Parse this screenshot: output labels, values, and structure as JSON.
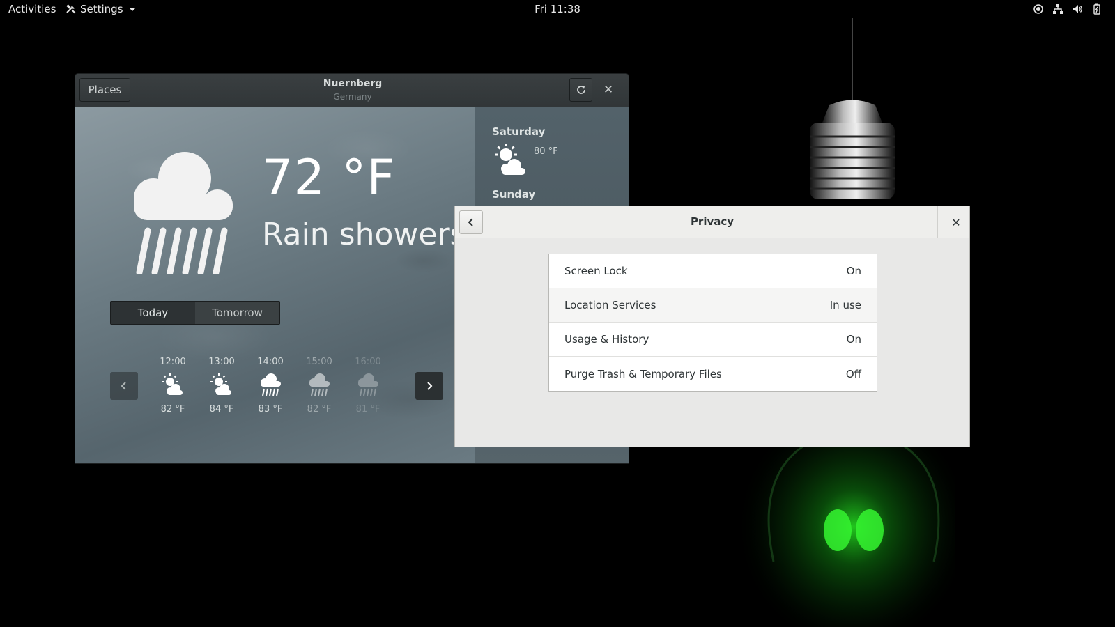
{
  "topbar": {
    "activities": "Activities",
    "app_menu": "Settings",
    "clock": "Fri 11:38",
    "tray_icons": [
      "location-icon",
      "network-icon",
      "volume-icon",
      "battery-icon"
    ]
  },
  "weather": {
    "places_button": "Places",
    "location": "Nuernberg",
    "country": "Germany",
    "temperature": "72 °F",
    "summary": "Rain showers",
    "tabs": [
      "Today",
      "Tomorrow"
    ],
    "hourly": [
      {
        "time": "12:00",
        "temp": "82 °F",
        "icon": "sun-cloud-icon"
      },
      {
        "time": "13:00",
        "temp": "84 °F",
        "icon": "sun-cloud-icon"
      },
      {
        "time": "14:00",
        "temp": "83 °F",
        "icon": "rain-icon"
      },
      {
        "time": "15:00",
        "temp": "82 °F",
        "icon": "rain-icon"
      },
      {
        "time": "16:00",
        "temp": "81 °F",
        "icon": "rain-icon"
      }
    ],
    "forecast": [
      {
        "day": "Saturday",
        "temp": "80 °F",
        "icon": "sun-cloud-icon"
      },
      {
        "day": "Sunday"
      }
    ]
  },
  "privacy": {
    "title": "Privacy",
    "rows": [
      {
        "label": "Screen Lock",
        "value": "On"
      },
      {
        "label": "Location Services",
        "value": "In use"
      },
      {
        "label": "Usage & History",
        "value": "On"
      },
      {
        "label": "Purge Trash & Temporary Files",
        "value": "Off"
      }
    ]
  }
}
